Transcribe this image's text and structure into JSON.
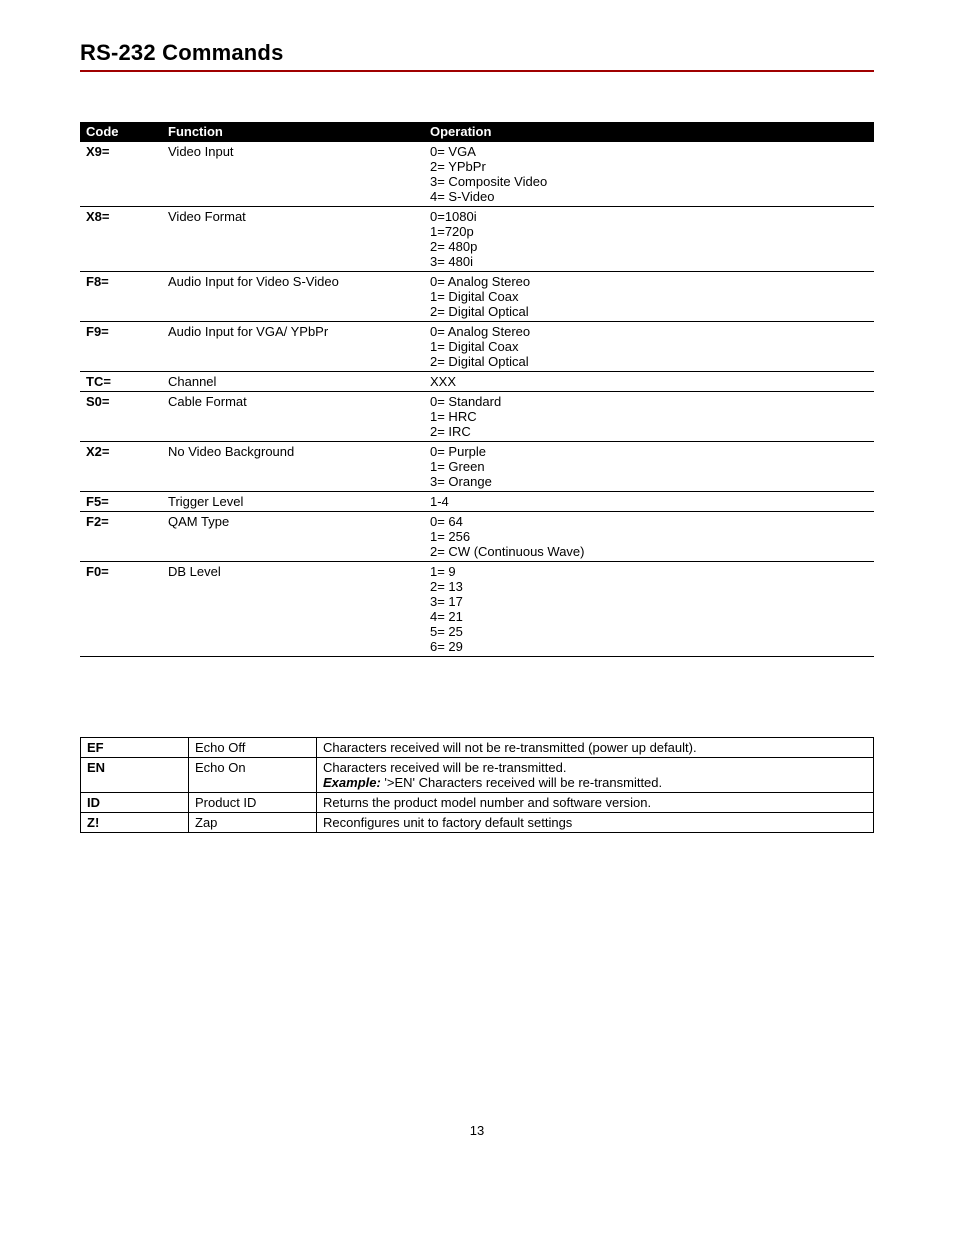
{
  "page": {
    "title": "RS-232 Commands",
    "number": "13"
  },
  "table1": {
    "headers": {
      "code": "Code",
      "function": "Function",
      "operation": "Operation"
    },
    "rows": [
      {
        "code": "X9=",
        "function": "Video Input",
        "operation": "0= VGA\n2= YPbPr\n3= Composite Video\n4= S-Video"
      },
      {
        "code": "X8=",
        "function": "Video Format",
        "operation": "0=1080i\n1=720p\n2= 480p\n3= 480i"
      },
      {
        "code": "F8=",
        "function": "Audio Input for Video S-Video",
        "operation": "0= Analog Stereo\n1= Digital Coax\n2= Digital Optical"
      },
      {
        "code": "F9=",
        "function": "Audio Input for VGA/ YPbPr",
        "operation": "0= Analog Stereo\n1= Digital Coax\n2= Digital Optical"
      },
      {
        "code": "TC=",
        "function": "Channel",
        "operation": "XXX"
      },
      {
        "code": "S0=",
        "function": "Cable Format",
        "operation": "0= Standard\n1= HRC\n2= IRC"
      },
      {
        "code": "X2=",
        "function": "No Video Background",
        "operation": "0= Purple\n1= Green\n3= Orange"
      },
      {
        "code": "F5=",
        "function": "Trigger Level",
        "operation": "1-4"
      },
      {
        "code": "F2=",
        "function": "QAM Type",
        "operation": "0= 64\n1= 256\n2= CW (Continuous Wave)"
      },
      {
        "code": "F0=",
        "function": "DB Level",
        "operation": "1= 9\n2= 13\n3= 17\n4= 21\n5= 25\n6= 29"
      }
    ]
  },
  "table2": {
    "rows": [
      {
        "code": "EF",
        "function": "Echo Off",
        "desc_pre": "Characters received will not be re-transmitted (power up default).",
        "example_label": "",
        "desc_post": ""
      },
      {
        "code": "EN",
        "function": "Echo On",
        "desc_pre": "Characters received will be re-transmitted.",
        "example_label": "Example:",
        "desc_post": " '>EN'  Characters received will be re-transmitted."
      },
      {
        "code": "ID",
        "function": "Product ID",
        "desc_pre": "Returns the product model number and software version.",
        "example_label": "",
        "desc_post": ""
      },
      {
        "code": "Z!",
        "function": "Zap",
        "desc_pre": "Reconfigures unit to factory default settings",
        "example_label": "",
        "desc_post": ""
      }
    ]
  }
}
